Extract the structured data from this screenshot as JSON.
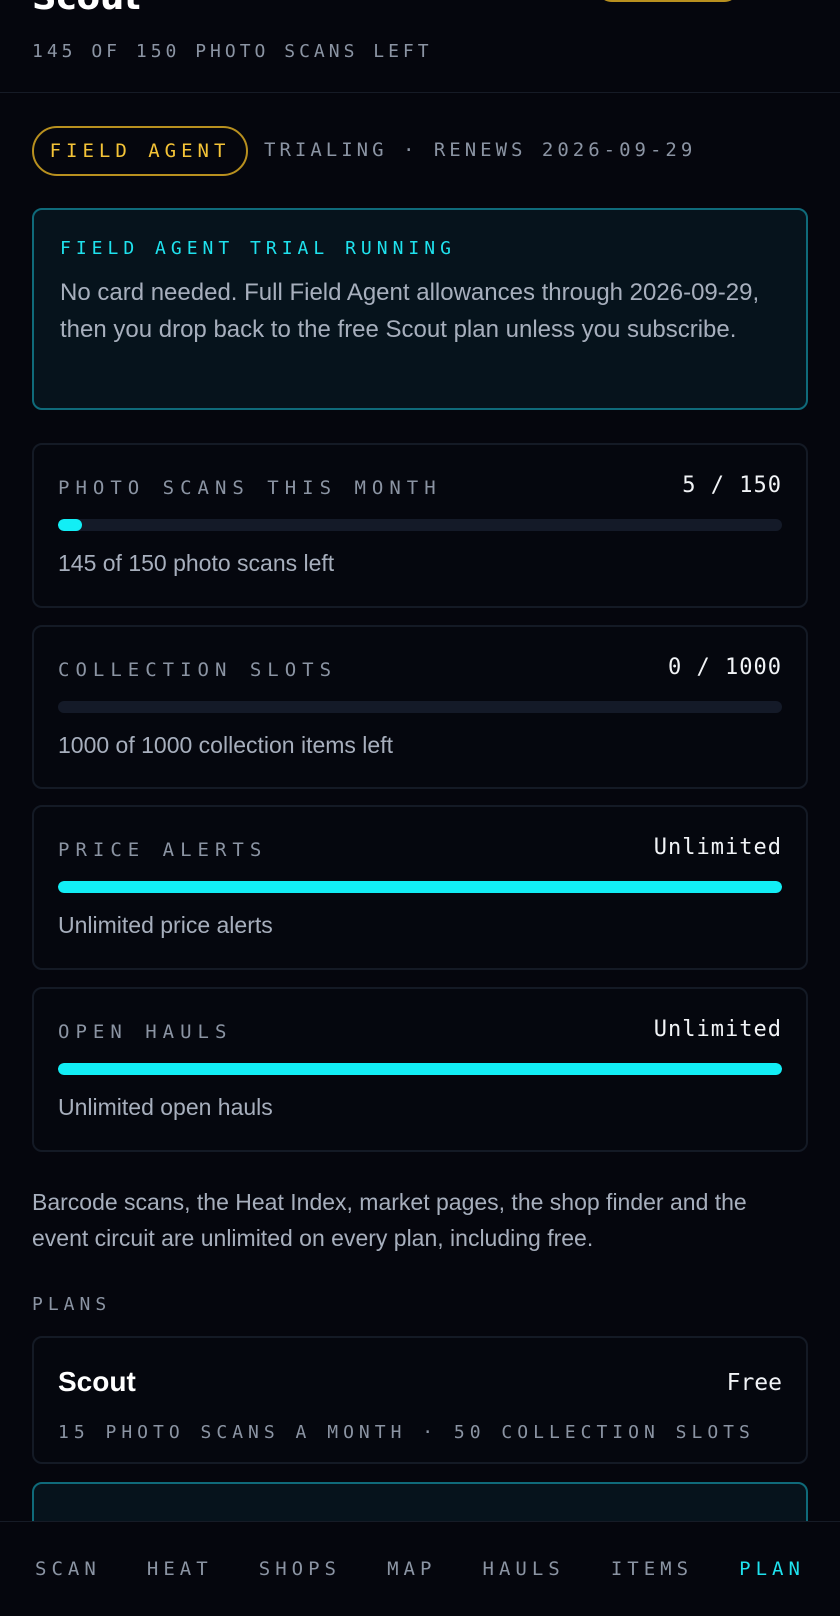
{
  "header": {
    "app_title": "Scout",
    "scans_left": "145 OF 150 PHOTO SCANS LEFT"
  },
  "status": {
    "plan_badge": "FIELD AGENT",
    "trial_status": "TRIALING · RENEWS 2026-09-29"
  },
  "notice": {
    "title": "FIELD AGENT TRIAL RUNNING",
    "body": "No card needed. Full Field Agent allowances through 2026-09-29, then you drop back to the free Scout plan unless you subscribe."
  },
  "usage": [
    {
      "label": "PHOTO SCANS THIS MONTH",
      "value": "5 / 150",
      "fill_fraction": 0.033,
      "note": "145 of 150 photo scans left"
    },
    {
      "label": "COLLECTION SLOTS",
      "value": "0 / 1000",
      "fill_fraction": 0,
      "note": "1000 of 1000 collection items left"
    },
    {
      "label": "PRICE ALERTS",
      "value": "Unlimited",
      "fill_fraction": 1,
      "note": "Unlimited price alerts"
    },
    {
      "label": "OPEN HAULS",
      "value": "Unlimited",
      "fill_fraction": 1,
      "note": "Unlimited open hauls"
    }
  ],
  "footnote": "Barcode scans, the Heat Index, market pages, the shop finder and the event circuit are unlimited on every plan, including free.",
  "plans": {
    "section_label": "PLANS",
    "items": [
      {
        "name": "Scout",
        "price": "Free",
        "desc": "15 PHOTO SCANS A MONTH · 50 COLLECTION SLOTS"
      }
    ]
  },
  "nav": {
    "items": [
      "SCAN",
      "HEAT",
      "SHOPS",
      "MAP",
      "HAULS",
      "ITEMS",
      "PLAN"
    ],
    "active": "PLAN"
  },
  "colors": {
    "accent_cyan": "#1fe2ee",
    "accent_gold": "#f5c437",
    "background": "#05060d"
  }
}
